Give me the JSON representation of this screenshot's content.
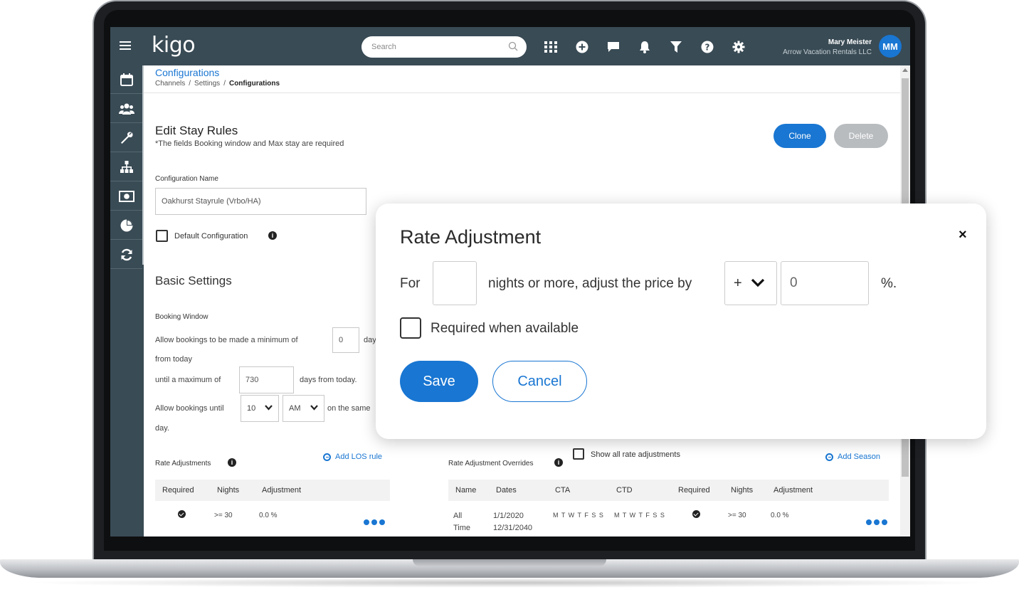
{
  "app": {
    "logo": "kigo",
    "search": {
      "placeholder": "Search"
    },
    "user": {
      "name": "Mary Meister",
      "company": "Arrow Vacation Rentals LLC",
      "initials": "MM"
    },
    "accent_color": "#1976d2",
    "nav_color": "#394b55"
  },
  "toolbar_icons": [
    "apps-grid-icon",
    "add-circle-icon",
    "chat-icon",
    "bell-icon",
    "filter-icon",
    "help-icon",
    "gear-icon"
  ],
  "sidebar": {
    "items": [
      "calendar-icon",
      "users-icon",
      "wrench-icon",
      "sitemap-icon",
      "money-icon",
      "pie-chart-icon",
      "sync-icon"
    ]
  },
  "header": {
    "title": "Configurations",
    "breadcrumb": [
      "Channels",
      "Settings",
      "Configurations"
    ],
    "separator": "/"
  },
  "page": {
    "title": "Edit Stay Rules",
    "subtitle": "*The fields Booking window and Max stay are required",
    "clone_label": "Clone",
    "delete_label": "Delete",
    "config_name_label": "Configuration Name",
    "config_name_value": "Oakhurst Stayrule (Vrbo/HA)",
    "default_config_label": "Default Configuration",
    "info_glyph": "i",
    "basic_settings_title": "Basic Settings",
    "booking_window_label": "Booking Window",
    "min_text": "Allow bookings to be made a minimum of",
    "min_value": "0",
    "min_suffix": "day",
    "from_today": "from today",
    "max_prefix": "until a maximum of",
    "max_value": "730",
    "max_suffix": "days from today.",
    "until_prefix": "Allow bookings until",
    "hour_value": "10",
    "ampm_value": "AM",
    "same_text": "on the same",
    "day_text": "day."
  },
  "rate_adjustments": {
    "title": "Rate Adjustments",
    "add_label": "Add LOS rule",
    "columns": [
      "Required",
      "Nights",
      "Adjustment"
    ],
    "rows": [
      {
        "required": true,
        "nights": ">= 30",
        "adjustment": "0.0 %"
      }
    ]
  },
  "overrides": {
    "title": "Rate Adjustment Overrides",
    "show_all_label": "Show all rate adjustments",
    "add_label": "Add Season",
    "columns": [
      "Name",
      "Dates",
      "CTA",
      "CTD",
      "Required",
      "Nights",
      "Adjustment"
    ],
    "rows": [
      {
        "name_line1": "All",
        "name_line2": "Time",
        "date_start": "1/1/2020",
        "date_end": "12/31/2040",
        "cta": "M T W T F S S",
        "ctd": "M T W T F S S",
        "required": true,
        "nights": ">= 30",
        "adjustment": "0.0 %"
      }
    ]
  },
  "modal": {
    "title": "Rate Adjustment",
    "close_glyph": "×",
    "for_label": "For",
    "nights_value": "",
    "middle_text": "nights or more, adjust the price by",
    "sign_value": "+",
    "amount_value": "0",
    "percent_suffix": "%.",
    "required_label": "Required when available",
    "save_label": "Save",
    "cancel_label": "Cancel"
  }
}
